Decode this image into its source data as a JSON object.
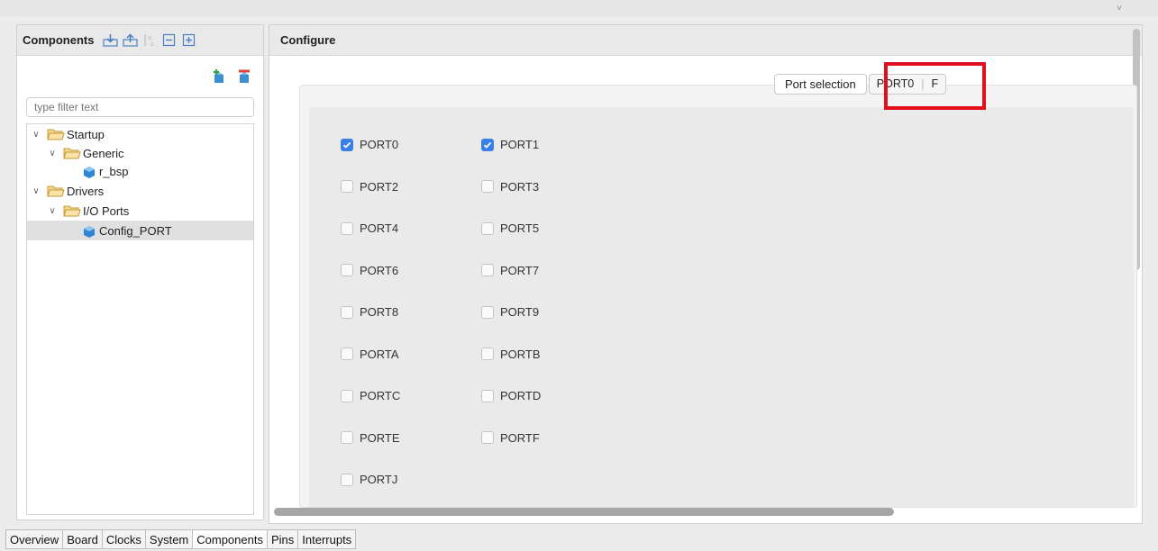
{
  "left": {
    "title": "Components",
    "filter_placeholder": "type filter text",
    "tree": [
      {
        "label": "Startup"
      },
      {
        "label": "Generic"
      },
      {
        "label": "r_bsp"
      },
      {
        "label": "Drivers"
      },
      {
        "label": "I/O Ports"
      },
      {
        "label": "Config_PORT"
      }
    ]
  },
  "right": {
    "title": "Configure",
    "tab_port_selection": "Port selection",
    "tab_port0": "PORT0",
    "tab_overflow": "F",
    "ports": [
      {
        "label": "PORT0",
        "checked": true
      },
      {
        "label": "PORT1",
        "checked": true
      },
      {
        "label": "PORT2",
        "checked": false
      },
      {
        "label": "PORT3",
        "checked": false
      },
      {
        "label": "PORT4",
        "checked": false
      },
      {
        "label": "PORT5",
        "checked": false
      },
      {
        "label": "PORT6",
        "checked": false
      },
      {
        "label": "PORT7",
        "checked": false
      },
      {
        "label": "PORT8",
        "checked": false
      },
      {
        "label": "PORT9",
        "checked": false
      },
      {
        "label": "PORTA",
        "checked": false
      },
      {
        "label": "PORTB",
        "checked": false
      },
      {
        "label": "PORTC",
        "checked": false
      },
      {
        "label": "PORTD",
        "checked": false
      },
      {
        "label": "PORTE",
        "checked": false
      },
      {
        "label": "PORTF",
        "checked": false
      },
      {
        "label": "PORTJ",
        "checked": false
      }
    ]
  },
  "bottom_tabs": [
    "Overview",
    "Board",
    "Clocks",
    "System",
    "Components",
    "Pins",
    "Interrupts"
  ],
  "active_bottom_tab": "Components",
  "colors": {
    "accent": "#3a7fe8",
    "highlight": "#e0101c"
  }
}
